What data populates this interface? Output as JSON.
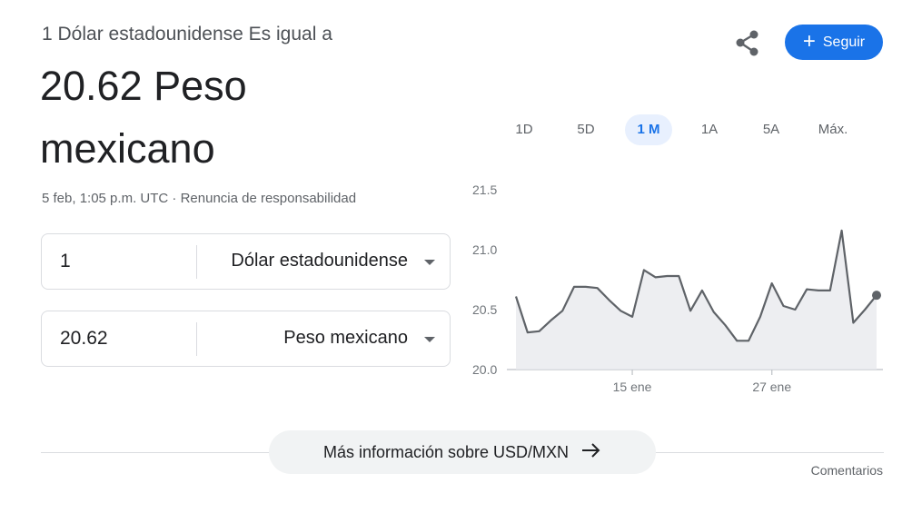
{
  "header": {
    "subtitle": "1 Dólar estadounidense Es igual a",
    "result_line1": "20.62 Peso",
    "result_line2": "mexicano",
    "timestamp": "5 feb, 1:05 p.m. UTC",
    "separator": " · ",
    "disclaimer": "Renuncia de responsabilidad"
  },
  "actions": {
    "share_icon": "share-icon",
    "follow_label": "Seguir",
    "follow_icon": "+",
    "accent": "#1a73e8"
  },
  "converter": {
    "from": {
      "amount": "1",
      "currency": "Dólar estadounidense"
    },
    "to": {
      "amount": "20.62",
      "currency": "Peso mexicano"
    }
  },
  "ranges": [
    {
      "label": "1D",
      "active": false
    },
    {
      "label": "5D",
      "active": false
    },
    {
      "label": "1 M",
      "active": true
    },
    {
      "label": "1A",
      "active": false
    },
    {
      "label": "5A",
      "active": false
    },
    {
      "label": "Máx.",
      "active": false
    }
  ],
  "chart_data": {
    "type": "area",
    "ylim": [
      20.0,
      21.5
    ],
    "yticks": [
      "21.5",
      "21.0",
      "20.5",
      "20.0"
    ],
    "ytick_values": [
      21.5,
      21.0,
      20.5,
      20.0
    ],
    "xticks": [
      {
        "label": "15 ene",
        "index": 10
      },
      {
        "label": "27 ene",
        "index": 22
      }
    ],
    "values": [
      20.61,
      20.31,
      20.32,
      20.41,
      20.49,
      20.69,
      20.69,
      20.68,
      20.58,
      20.49,
      20.44,
      20.83,
      20.77,
      20.78,
      20.78,
      20.49,
      20.66,
      20.48,
      20.37,
      20.24,
      20.24,
      20.44,
      20.72,
      20.53,
      20.5,
      20.67,
      20.66,
      20.66,
      21.16,
      20.39,
      20.5,
      20.62
    ],
    "line_color": "#5f6368",
    "fill_color": "#e8eaed",
    "grid": false
  },
  "footer": {
    "more_label": "Más información sobre USD/MXN",
    "arrow_icon": "arrow-right-icon",
    "comments": "Comentarios"
  }
}
